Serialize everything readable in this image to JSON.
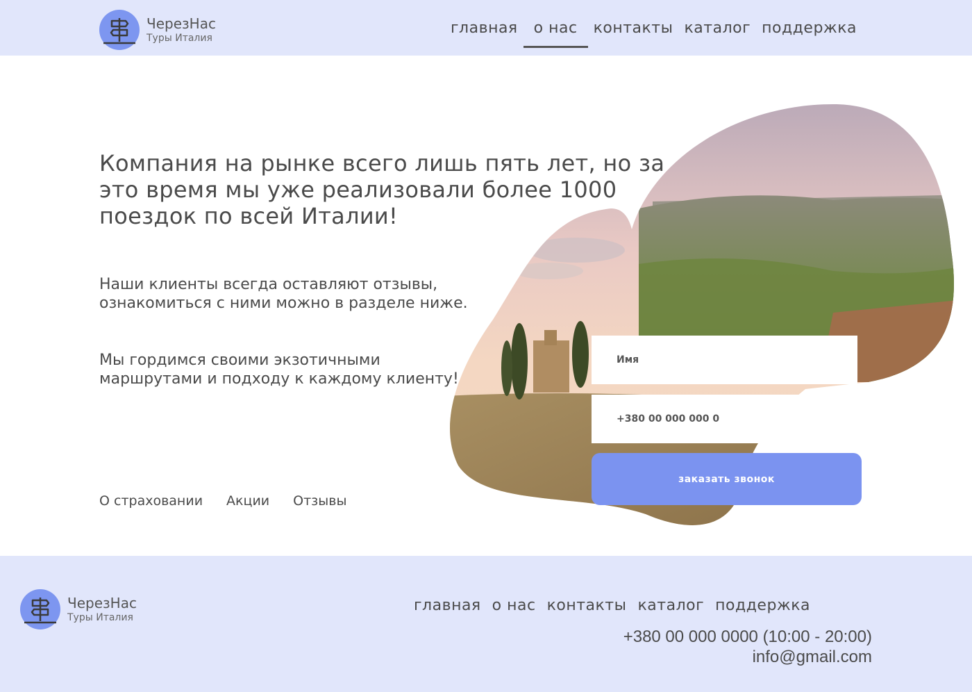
{
  "brand": {
    "name": "ЧерезНас",
    "tagline": "Туры Италия",
    "logo_color": "#7d96f0"
  },
  "header": {
    "nav": [
      {
        "label": "главная",
        "active": false
      },
      {
        "label": "о нас",
        "active": true
      },
      {
        "label": "контакты",
        "active": false
      },
      {
        "label": "каталог",
        "active": false
      },
      {
        "label": "поддержка",
        "active": false
      }
    ]
  },
  "hero": {
    "headline": "Компания на рынке всего лишь пять лет, но за это время мы уже реализовали более 1000 поездок по всей Италии!",
    "paragraph1": "Наши клиенты всегда оставляют отзывы, ознакомиться с ними можно в разделе ниже.",
    "paragraph2": "Мы гордимся своими экзотичными маршрутами и подходу к каждому клиенту!",
    "links": [
      "О страховании",
      "Акции",
      "Отзывы"
    ]
  },
  "form": {
    "name_placeholder": "Имя",
    "phone_placeholder": "+380 00 000 000 0",
    "submit_label": "заказать звонок",
    "button_color": "#7b93f0"
  },
  "footer": {
    "nav": [
      "главная",
      "о нас",
      "контакты",
      "каталог",
      "поддержка"
    ],
    "phone": "+380 00 000 0000 (10:00 - 20:00)",
    "email": "info@gmail.com"
  },
  "colors": {
    "header_bg": "#e1e6fb",
    "text": "#4a4a4a"
  }
}
